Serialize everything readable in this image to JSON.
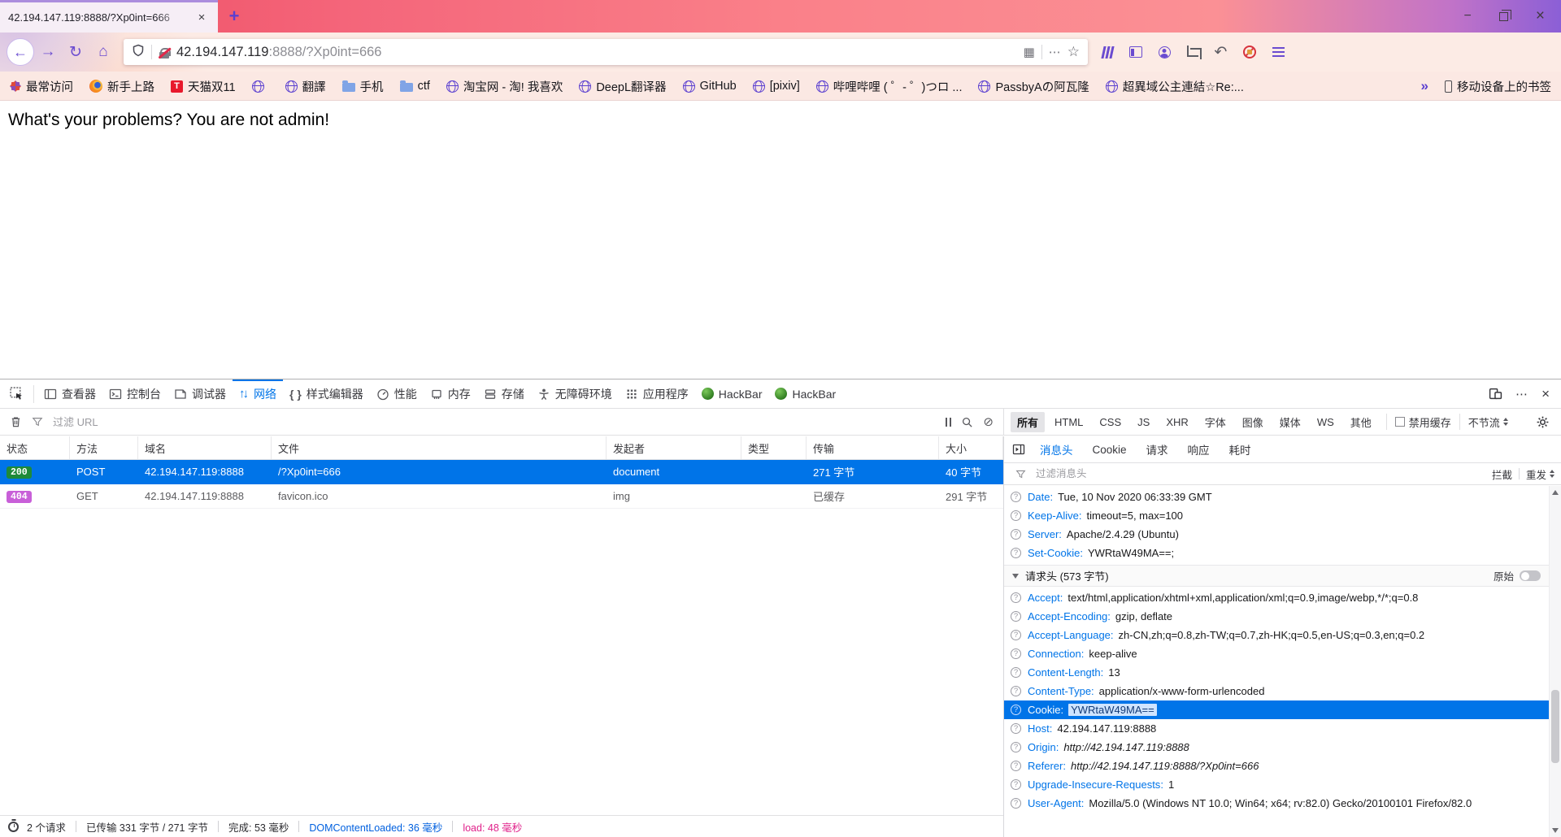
{
  "window": {
    "tab_title": "42.194.147.119:8888/?Xp0int=666",
    "new_tab": "+",
    "controls": {
      "minimize": "−",
      "close": "×"
    }
  },
  "navbar": {
    "back": "←",
    "forward": "→",
    "reload": "↻",
    "home": "⌂",
    "url_host": "42.194.147.119",
    "url_rest": ":8888/?Xp0int=666",
    "qr_icon": "▦",
    "page_actions": "⋯",
    "star": "☆",
    "undo": "↶"
  },
  "bookmarks": {
    "items": [
      {
        "icon": "gear",
        "label": "最常访问"
      },
      {
        "icon": "firefox",
        "label": "新手上路"
      },
      {
        "icon": "tmall",
        "label": "天猫双11"
      },
      {
        "icon": "globe",
        "label": ""
      },
      {
        "icon": "globe",
        "label": "翻譯"
      },
      {
        "icon": "folder",
        "label": "手机"
      },
      {
        "icon": "folder",
        "label": "ctf"
      },
      {
        "icon": "globe",
        "label": "淘宝网 - 淘! 我喜欢"
      },
      {
        "icon": "globe",
        "label": "DeepL翻译器"
      },
      {
        "icon": "globe",
        "label": "GitHub"
      },
      {
        "icon": "globe",
        "label": "[pixiv]"
      },
      {
        "icon": "globe",
        "label": "哔哩哔哩 ( ゜- ゜)つロ ..."
      },
      {
        "icon": "globe",
        "label": "PassbyAの阿瓦隆"
      },
      {
        "icon": "globe",
        "label": "超異域公主連結☆Re:..."
      }
    ],
    "overflow": "»",
    "mobile_label": "移动设备上的书签",
    "tmall_letter": "T"
  },
  "page": {
    "message": "What's your problems? You are not admin!"
  },
  "devtools": {
    "toolbar": {
      "tools": [
        "查看器",
        "控制台",
        "调试器",
        "网络",
        "样式编辑器",
        "性能",
        "内存",
        "存储",
        "无障碍环境",
        "应用程序",
        "HackBar",
        "HackBar"
      ],
      "active_tool": "网络",
      "close": "×",
      "menu_dots": "⋯"
    },
    "netfilter": {
      "url_placeholder": "过滤 URL",
      "types": [
        "所有",
        "HTML",
        "CSS",
        "JS",
        "XHR",
        "字体",
        "图像",
        "媒体",
        "WS",
        "其他"
      ],
      "active_type": "所有",
      "disable_cache": "禁用缓存",
      "throttle": "不节流",
      "block_icon": "⊘"
    },
    "table": {
      "columns": [
        "状态",
        "方法",
        "域名",
        "文件",
        "发起者",
        "类型",
        "传输",
        "大小"
      ],
      "rows": [
        {
          "status": "200",
          "method": "POST",
          "domain": "42.194.147.119:8888",
          "file": "/?Xp0int=666",
          "initiator": "document",
          "type": "",
          "transferred": "271 字节",
          "size": "40 字节",
          "selected": true
        },
        {
          "status": "404",
          "method": "GET",
          "domain": "42.194.147.119:8888",
          "file": "favicon.ico",
          "initiator": "img",
          "type": "",
          "transferred": "已缓存",
          "size": "291 字节",
          "selected": false
        }
      ]
    },
    "details": {
      "tabs": [
        "消息头",
        "Cookie",
        "请求",
        "响应",
        "耗时"
      ],
      "active_tab": "消息头",
      "filter_placeholder": "过滤消息头",
      "block_button": "拦截",
      "resend_button": "重发",
      "response_headers": [
        {
          "name": "Date",
          "value": "Tue, 10 Nov 2020 06:33:39 GMT"
        },
        {
          "name": "Keep-Alive",
          "value": "timeout=5, max=100"
        },
        {
          "name": "Server",
          "value": "Apache/2.4.29 (Ubuntu)"
        },
        {
          "name": "Set-Cookie",
          "value": "YWRtaW49MA==;"
        }
      ],
      "request_section_title": "请求头 (573 字节)",
      "raw_toggle_label": "原始",
      "request_headers": [
        {
          "name": "Accept",
          "value": "text/html,application/xhtml+xml,application/xml;q=0.9,image/webp,*/*;q=0.8"
        },
        {
          "name": "Accept-Encoding",
          "value": "gzip, deflate"
        },
        {
          "name": "Accept-Language",
          "value": "zh-CN,zh;q=0.8,zh-TW;q=0.7,zh-HK;q=0.5,en-US;q=0.3,en;q=0.2"
        },
        {
          "name": "Connection",
          "value": "keep-alive"
        },
        {
          "name": "Content-Length",
          "value": "13"
        },
        {
          "name": "Content-Type",
          "value": "application/x-www-form-urlencoded"
        },
        {
          "name": "Cookie",
          "value": "YWRtaW49MA==",
          "selected": true
        },
        {
          "name": "Host",
          "value": "42.194.147.119:8888"
        },
        {
          "name": "Origin",
          "value": "http://42.194.147.119:8888",
          "italic": true
        },
        {
          "name": "Referer",
          "value": "http://42.194.147.119:8888/?Xp0int=666",
          "italic": true
        },
        {
          "name": "Upgrade-Insecure-Requests",
          "value": "1"
        },
        {
          "name": "User-Agent",
          "value": "Mozilla/5.0 (Windows NT 10.0; Win64; x64; rv:82.0) Gecko/20100101 Firefox/82.0"
        }
      ]
    },
    "statusbar": {
      "requests": "2 个请求",
      "transferred": "已传输 331 字节 / 271 字节",
      "finish": "完成: 53 毫秒",
      "domcontentloaded": "DOMContentLoaded: 36 毫秒",
      "load": "load: 48 毫秒"
    }
  },
  "colors": {
    "selection_blue": "#0074e8",
    "status_200_green": "#1f8a39",
    "status_404_purple": "#c85fd8",
    "domcontentloaded_blue": "#0060df",
    "load_magenta": "#e0218a",
    "theme_pink": "#fa8089",
    "accent_purple": "#6a4bd0"
  }
}
